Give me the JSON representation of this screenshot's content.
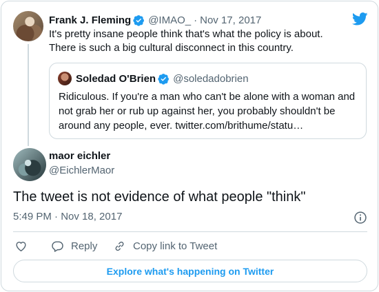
{
  "parent_tweet": {
    "name": "Frank J. Fleming",
    "handle": "@IMAO_",
    "separator": "·",
    "date": "Nov 17, 2017",
    "text": "It's pretty insane people think that's what the policy is about. There is such a big cultural disconnect in this country.",
    "avatar_icon": "user-avatar"
  },
  "quoted_tweet": {
    "name": "Soledad O'Brien",
    "handle": "@soledadobrien",
    "text": "Ridiculous. If you're a man who can't be alone with a woman and not grab her or rub up against her, you probably shouldn't be around any people, ever. twitter.com/brithume/statu…",
    "avatar_icon": "user-avatar"
  },
  "main_tweet": {
    "name": "maor eichler",
    "handle": "@EichlerMaor",
    "text": "The tweet is not evidence of what people \"think\"",
    "timestamp": "5:49 PM · Nov 18, 2017",
    "avatar_icon": "user-avatar"
  },
  "actions": {
    "like_icon": "heart-icon",
    "reply_label": "Reply",
    "reply_icon": "speech-bubble-icon",
    "copy_link_label": "Copy link to Tweet",
    "copy_link_icon": "link-icon"
  },
  "explore_button": {
    "label": "Explore what's happening on Twitter"
  },
  "colors": {
    "accent": "#1d9bf0",
    "text": "#0f1419",
    "muted": "#536471",
    "border": "#cfd9de"
  }
}
